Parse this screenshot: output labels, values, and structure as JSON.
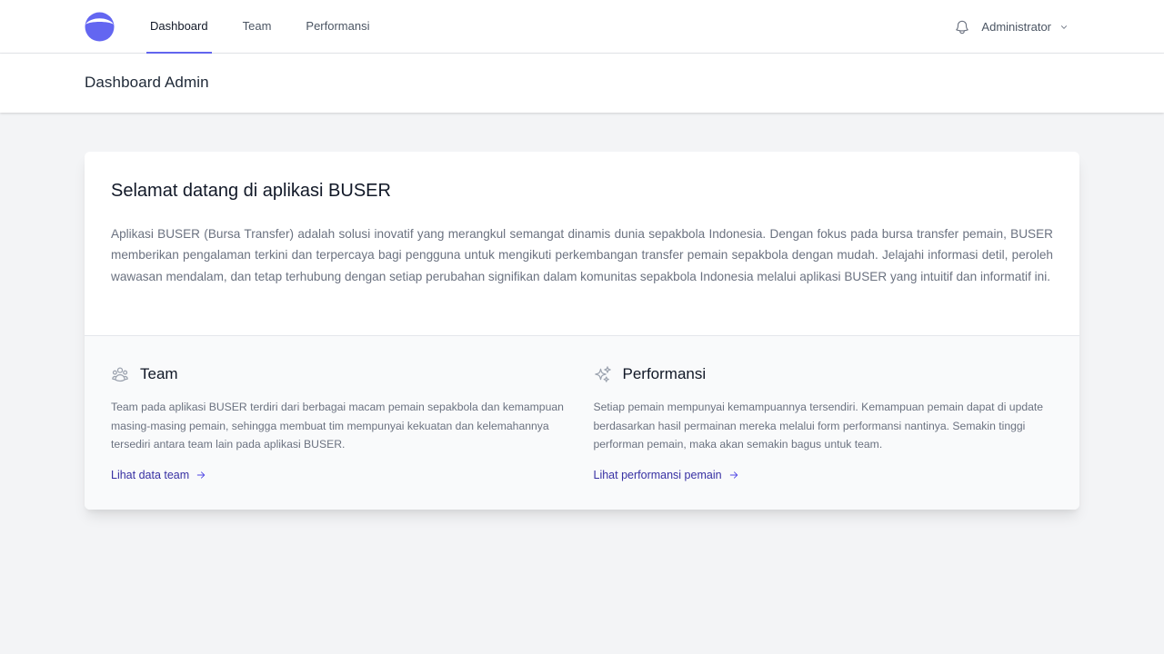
{
  "nav": {
    "items": [
      {
        "label": "Dashboard",
        "active": true
      },
      {
        "label": "Team",
        "active": false
      },
      {
        "label": "Performansi",
        "active": false
      }
    ],
    "user": "Administrator",
    "accent_color": "#6366f1"
  },
  "header": {
    "title": "Dashboard Admin"
  },
  "welcome": {
    "title": "Selamat datang di aplikasi BUSER",
    "body": "Aplikasi BUSER (Bursa Transfer) adalah solusi inovatif yang merangkul semangat dinamis dunia sepakbola Indonesia. Dengan fokus pada bursa transfer pemain, BUSER memberikan pengalaman terkini dan terpercaya bagi pengguna untuk mengikuti perkembangan transfer pemain sepakbola dengan mudah. Jelajahi informasi detil, peroleh wawasan mendalam, dan tetap terhubung dengan setiap perubahan signifikan dalam komunitas sepakbola Indonesia melalui aplikasi BUSER yang intuitif dan informatif ini."
  },
  "features": [
    {
      "icon": "user-group-icon",
      "title": "Team",
      "description": "Team pada aplikasi BUSER terdiri dari berbagai macam pemain sepakbola dan kemampuan masing-masing pemain, sehingga membuat tim mempunyai kekuatan dan kelemahannya tersediri antara team lain pada aplikasi BUSER.",
      "link": "Lihat data team"
    },
    {
      "icon": "sparkles-icon",
      "title": "Performansi",
      "description": "Setiap pemain mempunyai kemampuannya tersendiri. Kemampuan pemain dapat di update berdasarkan hasil permainan mereka melalui form performansi nantinya. Semakin tinggi performan pemain, maka akan semakin bagus untuk team.",
      "link": "Lihat performansi pemain"
    }
  ]
}
